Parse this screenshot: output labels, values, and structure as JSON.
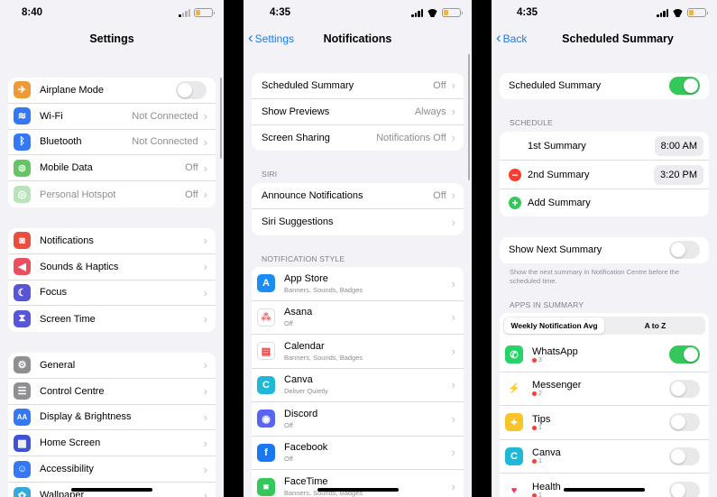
{
  "screen1": {
    "time": "8:40",
    "title": "Settings",
    "group1": [
      {
        "label": "Airplane Mode",
        "value": "",
        "icon": "airplane-icon",
        "color": "#f09a37",
        "glyph": "✈",
        "toggle": true
      },
      {
        "label": "Wi-Fi",
        "value": "Not Connected",
        "icon": "wifi-icon",
        "color": "#3478f6",
        "glyph": "≋"
      },
      {
        "label": "Bluetooth",
        "value": "Not Connected",
        "icon": "bluetooth-icon",
        "color": "#3478f6",
        "glyph": "ᛒ"
      },
      {
        "label": "Mobile Data",
        "value": "Off",
        "icon": "antenna-icon",
        "color": "#65c466",
        "glyph": "⊚"
      },
      {
        "label": "Personal Hotspot",
        "value": "Off",
        "icon": "hotspot-icon",
        "color": "#65c466",
        "glyph": "◎"
      }
    ],
    "group2": [
      {
        "label": "Notifications",
        "icon": "bell-icon",
        "color": "#eb4e3d",
        "glyph": "◙"
      },
      {
        "label": "Sounds & Haptics",
        "icon": "speaker-icon",
        "color": "#eb4e5e",
        "glyph": "◀"
      },
      {
        "label": "Focus",
        "icon": "moon-icon",
        "color": "#5856d6",
        "glyph": "☾"
      },
      {
        "label": "Screen Time",
        "icon": "hourglass-icon",
        "color": "#5856d6",
        "glyph": "⧗"
      }
    ],
    "group3": [
      {
        "label": "General",
        "icon": "gear-icon",
        "color": "#8e8e93",
        "glyph": "⚙"
      },
      {
        "label": "Control Centre",
        "icon": "sliders-icon",
        "color": "#8e8e93",
        "glyph": "☰"
      },
      {
        "label": "Display & Brightness",
        "icon": "text-size-icon",
        "color": "#3478f6",
        "glyph": "AA"
      },
      {
        "label": "Home Screen",
        "icon": "grid-icon",
        "color": "#3f51d6",
        "glyph": "▦"
      },
      {
        "label": "Accessibility",
        "icon": "accessibility-icon",
        "color": "#3478f6",
        "glyph": "☺"
      },
      {
        "label": "Wallpaper",
        "icon": "flower-icon",
        "color": "#34aadc",
        "glyph": "✿"
      }
    ]
  },
  "screen2": {
    "time": "4:35",
    "back": "Settings",
    "title": "Notifications",
    "group1": [
      {
        "label": "Scheduled Summary",
        "value": "Off"
      },
      {
        "label": "Show Previews",
        "value": "Always"
      },
      {
        "label": "Screen Sharing",
        "value": "Notifications Off"
      }
    ],
    "siri_header": "SIRI",
    "siri": [
      {
        "label": "Announce Notifications",
        "value": "Off"
      },
      {
        "label": "Siri Suggestions",
        "value": ""
      }
    ],
    "style_header": "NOTIFICATION STYLE",
    "apps": [
      {
        "name": "App Store",
        "sub": "Banners, Sounds, Badges",
        "icon": "app-store-icon",
        "color": "#1a8cf5",
        "glyph": "A"
      },
      {
        "name": "Asana",
        "sub": "Off",
        "icon": "asana-icon",
        "color": "#ffffff",
        "glyph": "⁂"
      },
      {
        "name": "Calendar",
        "sub": "Banners, Sounds, Badges",
        "icon": "calendar-icon",
        "color": "#ffffff",
        "glyph": "▤"
      },
      {
        "name": "Canva",
        "sub": "Deliver Quietly",
        "icon": "canva-icon",
        "color": "#1fb8d6",
        "glyph": "C"
      },
      {
        "name": "Discord",
        "sub": "Off",
        "icon": "discord-icon",
        "color": "#5865f2",
        "glyph": "◉"
      },
      {
        "name": "Facebook",
        "sub": "Off",
        "icon": "facebook-icon",
        "color": "#1877f2",
        "glyph": "f"
      },
      {
        "name": "FaceTime",
        "sub": "Banners, Sounds, Badges",
        "icon": "facetime-icon",
        "color": "#34c759",
        "glyph": "■"
      }
    ]
  },
  "screen3": {
    "time": "4:35",
    "back": "Back",
    "title": "Scheduled Summary",
    "toggle_label": "Scheduled Summary",
    "schedule_header": "SCHEDULE",
    "first_label": "1st Summary",
    "first_time": "8:00 AM",
    "second_label": "2nd Summary",
    "second_time": "3:20 PM",
    "add_label": "Add Summary",
    "next_label": "Show Next Summary",
    "next_note": "Show the next summary in Notification Centre before the scheduled time.",
    "apps_header": "APPS IN SUMMARY",
    "seg_left": "Weekly Notification Avg",
    "seg_right": "A to Z",
    "apps": [
      {
        "name": "WhatsApp",
        "count": "3",
        "on": true,
        "icon": "whatsapp-icon",
        "color": "#25d366",
        "glyph": "✆"
      },
      {
        "name": "Messenger",
        "count": "2",
        "on": false,
        "icon": "messenger-icon",
        "color": "#ffffff",
        "glyph": "⚡"
      },
      {
        "name": "Tips",
        "count": "1",
        "on": false,
        "icon": "lightbulb-icon",
        "color": "#f7c52b",
        "glyph": "✦"
      },
      {
        "name": "Canva",
        "count": "1",
        "on": false,
        "icon": "canva-icon",
        "color": "#1fb8d6",
        "glyph": "C"
      },
      {
        "name": "Health",
        "count": "1",
        "on": false,
        "icon": "heart-icon",
        "color": "#ffffff",
        "glyph": "♥"
      }
    ]
  }
}
